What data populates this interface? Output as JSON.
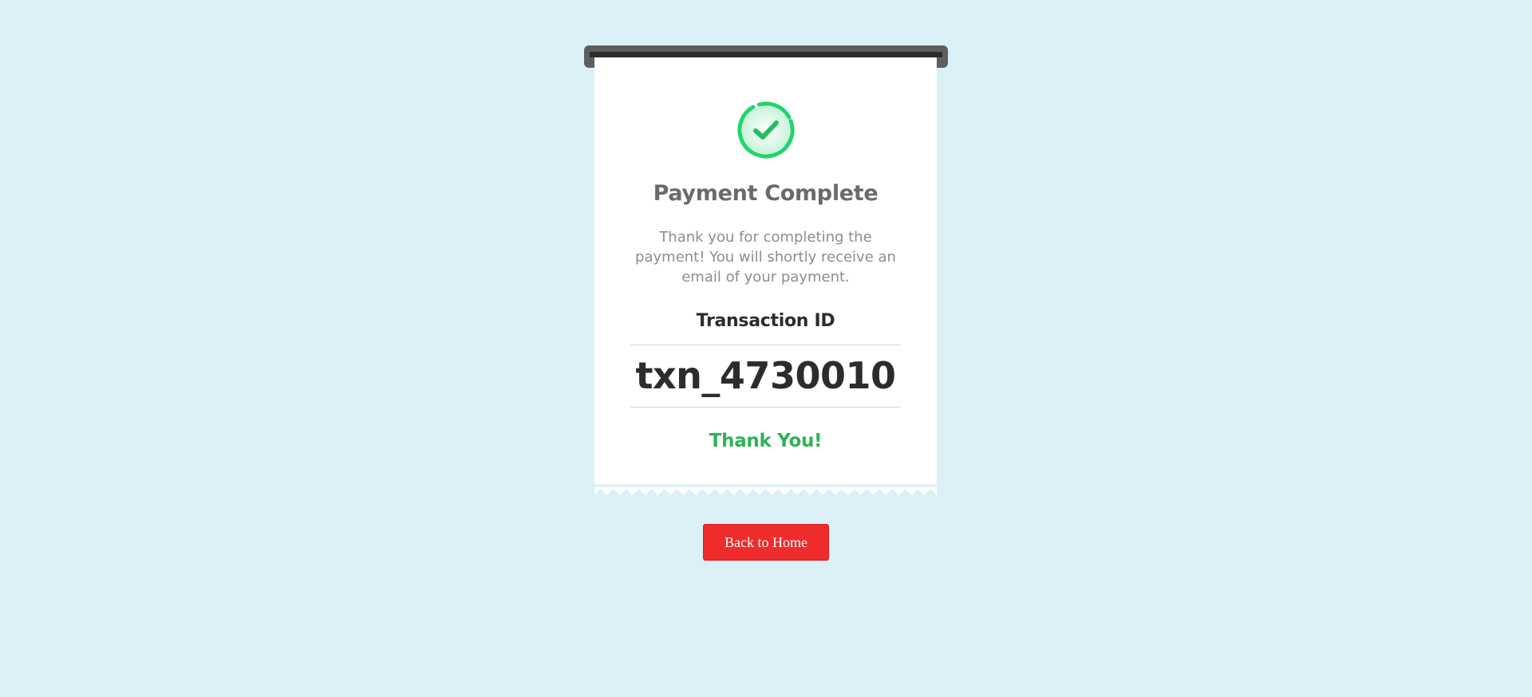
{
  "receipt": {
    "title": "Payment Complete",
    "message": "Thank you for completing the payment! You will shortly receive an email of your payment.",
    "transaction_label": "Transaction ID",
    "transaction_id": "txn_4730010",
    "thanks": "Thank You!"
  },
  "actions": {
    "back_home_label": "Back to Home"
  },
  "icons": {
    "success": "check-circle-icon"
  },
  "colors": {
    "background": "#dcf0f8",
    "success_green": "#1fd66a",
    "thanks_green": "#2db356",
    "button_red": "#ee2c2c"
  }
}
